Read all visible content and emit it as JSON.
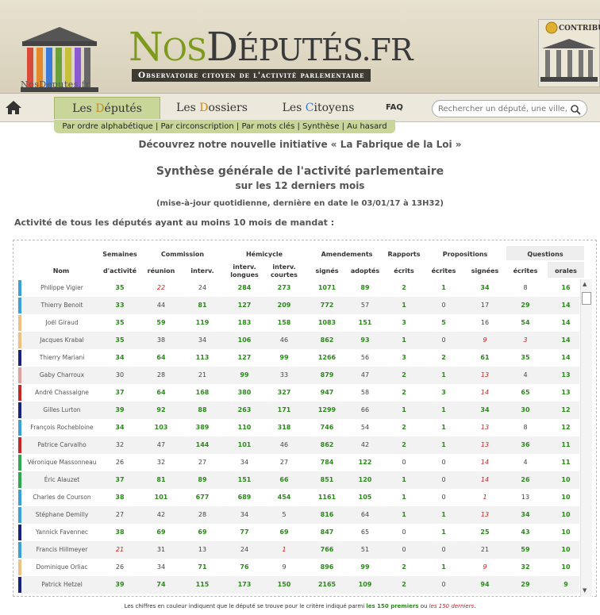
{
  "header": {
    "logo_caption": "NosDeputes.fr",
    "title_first": "N",
    "title_os": "OS",
    "title_d": "D",
    "title_rest": "ÉPUTÉS",
    "title_tld": ".FR",
    "subtitle": "Observatoire citoyen de l'activité parlementaire",
    "contribuer": "CONTRIBUER"
  },
  "nav": {
    "tabs": [
      {
        "pre": "Les ",
        "accent": "D",
        "post": "éputés",
        "active": true
      },
      {
        "pre": "Les ",
        "accent": "D",
        "post": "ossiers",
        "active": false
      },
      {
        "pre": "Les ",
        "accent": "C",
        "post": "itoyens",
        "active": false
      }
    ],
    "faq": "FAQ",
    "search_placeholder": "Rechercher un député, une ville, un mot, ...",
    "subnav": "Par ordre alphabétique | Par circonscription | Par mots clés | Synthèse | Au hasard"
  },
  "initiative": "Découvrez notre nouvelle initiative « La Fabrique de la Loi »",
  "synthese_title": "Synthèse générale de l'activité parlementaire",
  "synthese_subtitle": "sur les 12 derniers mois",
  "update_note": "(mise-à-jour quotidienne, dernière en date le 03/01/17 à 13H32)",
  "activity_title": "Activité de tous les députés ayant au moins 10 mois de mandat :",
  "table": {
    "groups": [
      "Semaines",
      "Commission",
      "Hémicycle",
      "Amendements",
      "Rapports",
      "Propositions",
      "Questions"
    ],
    "columns": [
      "Nom",
      "d'activité",
      "réunion",
      "interv.",
      "interv. longues",
      "interv. courtes",
      "signés",
      "adoptés",
      "écrits",
      "écrites",
      "signées",
      "écrites",
      "orales"
    ],
    "rows": [
      {
        "name": "Philippe Vigier",
        "color": "#3aa0d8",
        "v": [
          "35",
          "22",
          "24",
          "284",
          "273",
          "1071",
          "89",
          "2",
          "1",
          "34",
          "8",
          "16"
        ],
        "s": [
          "g",
          "r",
          "n",
          "g",
          "g",
          "g",
          "g",
          "g",
          "g",
          "g",
          "n",
          "g"
        ]
      },
      {
        "name": "Thierry Benoit",
        "color": "#3aa0d8",
        "v": [
          "33",
          "44",
          "81",
          "127",
          "209",
          "772",
          "57",
          "1",
          "0",
          "17",
          "29",
          "14"
        ],
        "s": [
          "g",
          "n",
          "g",
          "g",
          "g",
          "g",
          "n",
          "g",
          "n",
          "n",
          "g",
          "g"
        ]
      },
      {
        "name": "Joël Giraud",
        "color": "#f0c080",
        "v": [
          "35",
          "59",
          "119",
          "183",
          "158",
          "1083",
          "151",
          "3",
          "5",
          "16",
          "54",
          "14"
        ],
        "s": [
          "g",
          "g",
          "g",
          "g",
          "g",
          "g",
          "g",
          "g",
          "g",
          "n",
          "g",
          "g"
        ]
      },
      {
        "name": "Jacques Krabal",
        "color": "#f0c080",
        "v": [
          "35",
          "38",
          "34",
          "106",
          "46",
          "862",
          "93",
          "1",
          "0",
          "9",
          "3",
          "14"
        ],
        "s": [
          "g",
          "n",
          "n",
          "g",
          "n",
          "g",
          "g",
          "g",
          "n",
          "r",
          "r",
          "g"
        ]
      },
      {
        "name": "Thierry Mariani",
        "color": "#1a237e",
        "v": [
          "34",
          "64",
          "113",
          "127",
          "99",
          "1266",
          "56",
          "3",
          "2",
          "61",
          "35",
          "14"
        ],
        "s": [
          "g",
          "g",
          "g",
          "g",
          "g",
          "g",
          "n",
          "g",
          "g",
          "g",
          "g",
          "g"
        ]
      },
      {
        "name": "Gaby Charroux",
        "color": "#e0a0a0",
        "v": [
          "30",
          "28",
          "21",
          "99",
          "33",
          "879",
          "47",
          "2",
          "1",
          "13",
          "4",
          "13"
        ],
        "s": [
          "n",
          "n",
          "n",
          "g",
          "n",
          "g",
          "n",
          "g",
          "g",
          "r",
          "n",
          "g"
        ]
      },
      {
        "name": "André Chassaigne",
        "color": "#c62828",
        "v": [
          "37",
          "64",
          "168",
          "380",
          "327",
          "947",
          "58",
          "2",
          "3",
          "14",
          "65",
          "13"
        ],
        "s": [
          "g",
          "g",
          "g",
          "g",
          "g",
          "g",
          "n",
          "g",
          "g",
          "r",
          "g",
          "g"
        ]
      },
      {
        "name": "Gilles Lurton",
        "color": "#1a237e",
        "v": [
          "39",
          "92",
          "88",
          "263",
          "171",
          "1299",
          "66",
          "1",
          "1",
          "34",
          "30",
          "12"
        ],
        "s": [
          "g",
          "g",
          "g",
          "g",
          "g",
          "g",
          "n",
          "g",
          "g",
          "g",
          "g",
          "g"
        ]
      },
      {
        "name": "François Rochebloine",
        "color": "#3aa0d8",
        "v": [
          "34",
          "103",
          "389",
          "110",
          "318",
          "746",
          "54",
          "2",
          "1",
          "13",
          "8",
          "12"
        ],
        "s": [
          "g",
          "g",
          "g",
          "g",
          "g",
          "g",
          "n",
          "g",
          "g",
          "r",
          "n",
          "g"
        ]
      },
      {
        "name": "Patrice Carvalho",
        "color": "#c62828",
        "v": [
          "32",
          "47",
          "144",
          "101",
          "46",
          "862",
          "42",
          "2",
          "1",
          "13",
          "36",
          "11"
        ],
        "s": [
          "n",
          "n",
          "g",
          "g",
          "n",
          "g",
          "n",
          "g",
          "g",
          "r",
          "g",
          "g"
        ]
      },
      {
        "name": "Véronique Massonneau",
        "color": "#2ea84f",
        "v": [
          "26",
          "32",
          "27",
          "34",
          "27",
          "784",
          "122",
          "0",
          "0",
          "14",
          "4",
          "11"
        ],
        "s": [
          "n",
          "n",
          "n",
          "n",
          "n",
          "g",
          "g",
          "n",
          "n",
          "r",
          "n",
          "g"
        ]
      },
      {
        "name": "Éric Alauzet",
        "color": "#2ea84f",
        "v": [
          "37",
          "81",
          "89",
          "151",
          "66",
          "851",
          "120",
          "1",
          "0",
          "14",
          "26",
          "10"
        ],
        "s": [
          "g",
          "g",
          "g",
          "g",
          "g",
          "g",
          "g",
          "g",
          "n",
          "r",
          "g",
          "g"
        ]
      },
      {
        "name": "Charles de Courson",
        "color": "#3aa0d8",
        "v": [
          "38",
          "101",
          "677",
          "689",
          "454",
          "1161",
          "105",
          "1",
          "0",
          "1",
          "13",
          "10"
        ],
        "s": [
          "g",
          "g",
          "g",
          "g",
          "g",
          "g",
          "g",
          "g",
          "n",
          "r",
          "n",
          "g"
        ]
      },
      {
        "name": "Stéphane Demilly",
        "color": "#3aa0d8",
        "v": [
          "27",
          "42",
          "28",
          "34",
          "5",
          "816",
          "64",
          "1",
          "1",
          "13",
          "34",
          "10"
        ],
        "s": [
          "n",
          "n",
          "n",
          "n",
          "n",
          "g",
          "n",
          "g",
          "g",
          "r",
          "g",
          "g"
        ]
      },
      {
        "name": "Yannick Favennec",
        "color": "#1a237e",
        "v": [
          "38",
          "69",
          "69",
          "77",
          "69",
          "847",
          "65",
          "0",
          "1",
          "25",
          "43",
          "10"
        ],
        "s": [
          "g",
          "g",
          "g",
          "g",
          "g",
          "g",
          "n",
          "n",
          "g",
          "g",
          "g",
          "g"
        ]
      },
      {
        "name": "Francis Hillmeyer",
        "color": "#3aa0d8",
        "v": [
          "21",
          "31",
          "13",
          "24",
          "1",
          "766",
          "51",
          "0",
          "0",
          "21",
          "59",
          "10"
        ],
        "s": [
          "r",
          "n",
          "n",
          "n",
          "r",
          "g",
          "n",
          "n",
          "n",
          "n",
          "g",
          "g"
        ]
      },
      {
        "name": "Dominique Orliac",
        "color": "#f0c080",
        "v": [
          "26",
          "34",
          "71",
          "76",
          "9",
          "896",
          "99",
          "2",
          "1",
          "9",
          "32",
          "10"
        ],
        "s": [
          "n",
          "n",
          "g",
          "g",
          "n",
          "g",
          "g",
          "g",
          "g",
          "r",
          "g",
          "g"
        ]
      },
      {
        "name": "Patrick Hetzel",
        "color": "#1a237e",
        "v": [
          "39",
          "74",
          "115",
          "173",
          "150",
          "2165",
          "109",
          "2",
          "0",
          "94",
          "29",
          "9"
        ],
        "s": [
          "g",
          "g",
          "g",
          "g",
          "g",
          "g",
          "g",
          "g",
          "n",
          "g",
          "g",
          "g"
        ]
      }
    ]
  },
  "footnote": {
    "pre": "Les chiffres en couleur indiquent que le député se trouve pour le critère indiqué parmi ",
    "top": "les 150 premiers",
    "mid": " ou ",
    "bottom": "les 150 derniers",
    "post": "."
  },
  "colors": {
    "accent_green": "#7d9a1d",
    "good": "#2a8a1a",
    "bad": "#c22222"
  }
}
